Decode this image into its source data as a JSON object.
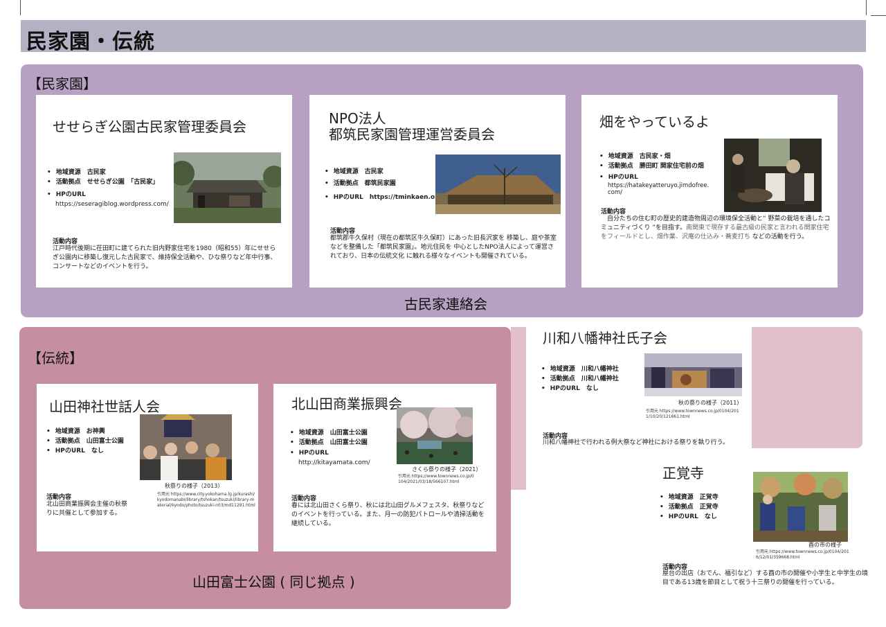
{
  "page_title": "民家園・伝統",
  "minkaen": {
    "label": "【民家園】",
    "footer": "古民家連絡会",
    "cards": [
      {
        "title": "せせらぎ公園古民家管理委員会",
        "bullets": [
          "地域資源　古民家",
          "活動拠点　せせらぎ公園　「古民家」",
          "HPのURL"
        ],
        "url": "https://seseragiblog.wordpress.com/",
        "activity_heading": "活動内容",
        "activity": "江戸時代後期に茌田町に建てられた旧内野家住宅を1980（昭和55）年にせせらぎ公園内に移築し復元した古民家で、維持保全活動や、ひな祭りなど年中行事、コンサートなどのイベントを行う。"
      },
      {
        "title_line1": "NPO法人",
        "title_line2": "都筑民家園管理運営委員会",
        "bullets": [
          "地域資源　古民家",
          "活動拠点　都筑民家園",
          "HPのURL　https://tminkaen.org/"
        ],
        "activity_heading": "活動内容",
        "activity": "都筑郡牛久保村（現在の都筑区牛久保町）にあった旧長沢家を 移築し、庭や茶室などを整備した「都筑民家園」。地元住民を 中心としたNPO法人によって運営されており、日本の伝統文化 に触れる様々なイベントも開催されている。"
      },
      {
        "title": "畑をやっているよ",
        "bullets": [
          "地域資源　古民家・畑",
          "活動拠点　勝田町 関家住宅前の畑",
          "HPのURL"
        ],
        "url": "https://hatakeyatteruyo.jimdofree.com/",
        "activity_heading": "活動内容",
        "activity_a": "　自分たちの住む町の歴史的建造物周辺の環境保全活動と“ 野菜の栽培を通したコミュニティづくり ”を目指す。",
        "activity_b": "南関東で現存する最古級の民家と言われる関家住宅をフィールドとし、畑作業、沢庵の仕込み・蕎麦打ち",
        "activity_c": " などの活動を行う。"
      }
    ]
  },
  "dento": {
    "label": "【伝統】",
    "footer": "山田富士公園 ( 同じ拠点 )",
    "cards": [
      {
        "title": "山田神社世話人会",
        "bullets": [
          "地域資源　お神輿",
          "活動拠点　山田富士公園",
          "HPのURL　なし"
        ],
        "caption": "秋祭りの様子（2013）",
        "ref": "引用元 https://www.city.yokohama.lg.jp/kurashi/kyodomanabi/library/tshokan/tsuzuki/library-material/kyodo/photo/tsuzuki-n03/md11291.html",
        "activity_heading": "活動内容",
        "activity": "北山田商業振興会主催の秋祭りに共催として参加する。"
      },
      {
        "title": "北山田商業振興会",
        "bullets": [
          "地域資源　山田富士公園",
          "活動拠点　山田富士公園",
          "HPのURL"
        ],
        "url": "http://kitayamata.com/",
        "caption": "さくら祭りの様子（2021）",
        "ref": "引用元 https://www.townnews.co.jp/0104/2021/03/18/566107.html",
        "activity_heading": "活動内容",
        "activity": "春には北山田さくら祭り、秋には北山田グルメフェスタ、秋祭りなどのイベントを行っている。また、月一の防犯パトロールや清掃活動を継続している。"
      }
    ]
  },
  "kawawa": {
    "title": "川和八幡神社氏子会",
    "bullets": [
      "地域資源　川和八幡神社",
      "活動拠点　川和八幡神社",
      "HPのURL　なし"
    ],
    "caption": "秋の祭りの様子（2011）",
    "ref": "引用元 https://www.townnews.co.jp/0104/2011/10/20/121661.html",
    "activity_heading": "活動内容",
    "activity": "川和八幡神社で行われる例大祭など神社における祭りを執り行う。"
  },
  "shogakuji": {
    "title": "正覚寺",
    "bullets": [
      "地域資源　正覚寺",
      "活動拠点　正覚寺",
      "HPのURL　なし"
    ],
    "caption": "酉の市の様子",
    "ref": "引用元 https://www.townnews.co.jp/0104/2016/12/01/359668.html",
    "activity_heading": "活動内容",
    "activity": "屋台の出店（おでん、福引など）する酉の市の開催や小学生と中学生の境目である13歳を節目として祝う十三祭りの開催を行っている。"
  }
}
